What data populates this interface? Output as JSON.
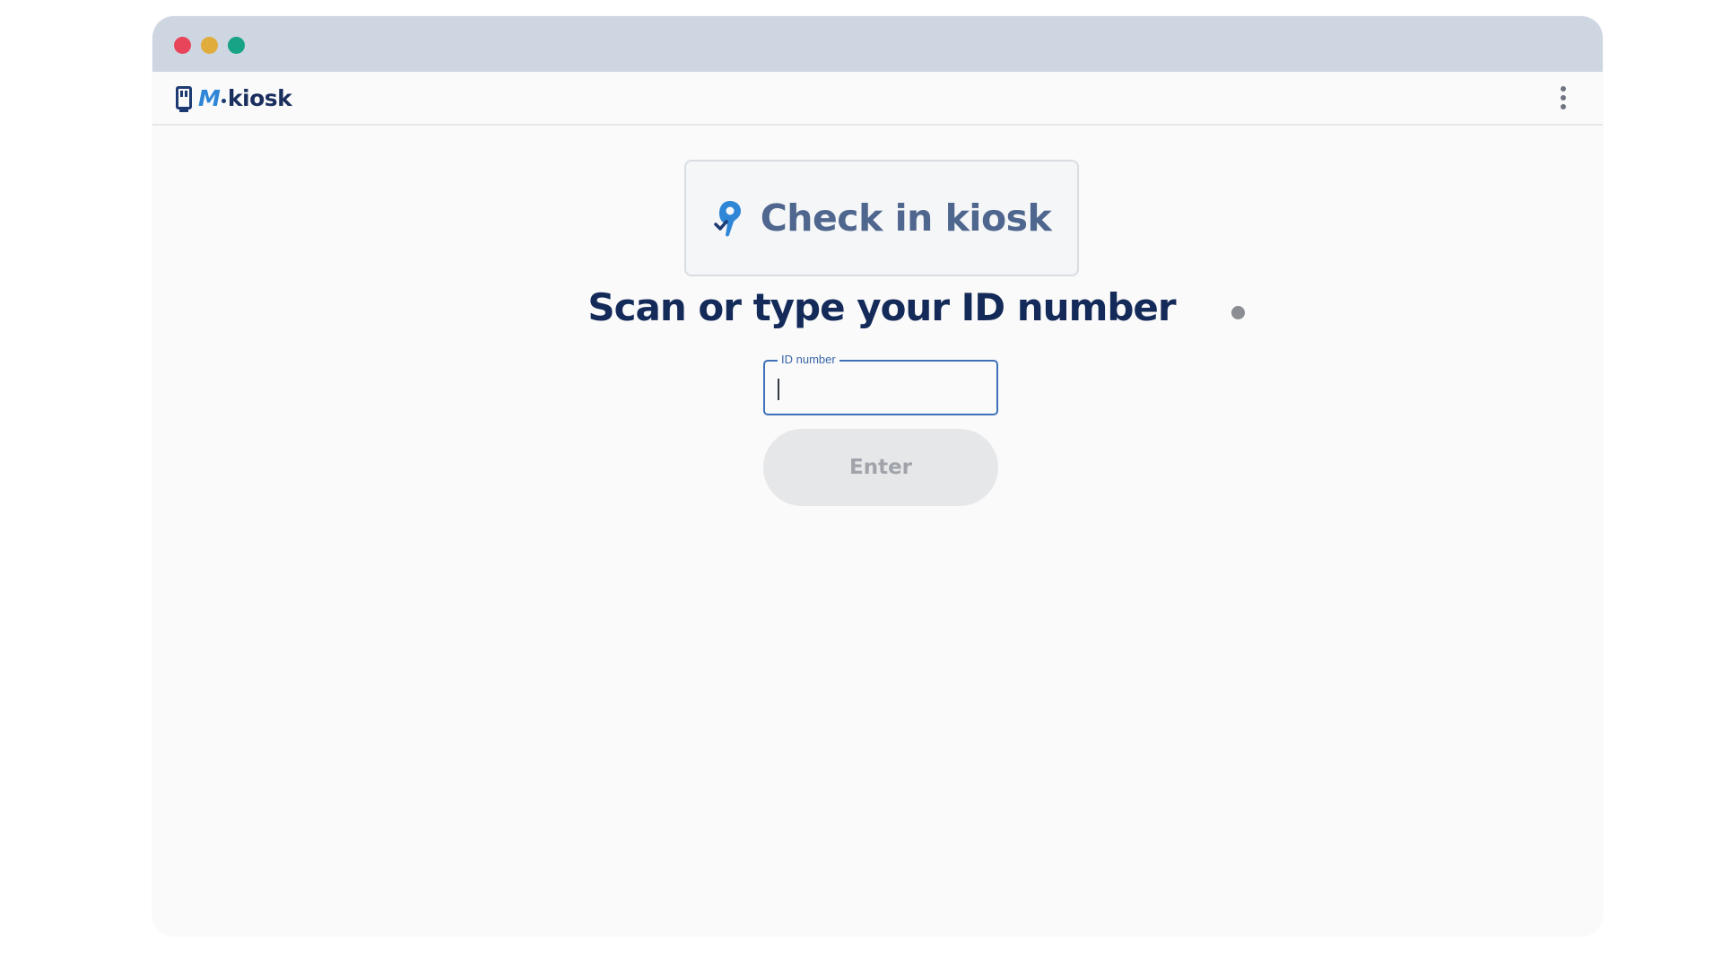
{
  "app": {
    "logo_m": "M",
    "logo_text": "kiosk"
  },
  "header": {
    "menu_icon": "more-vertical-icon"
  },
  "card": {
    "icon": "check-in-hand-icon",
    "title": "Check in kiosk",
    "icon_color": "#2f86d6"
  },
  "main": {
    "heading": "Scan or type your ID number",
    "id_field": {
      "label": "ID number",
      "value": ""
    },
    "enter_label": "Enter"
  },
  "colors": {
    "titlebar": "#cdd6e1",
    "heading": "#142a58",
    "field_border": "#3f70b8",
    "button_disabled_bg": "#e6e7e9",
    "window_red": "#e8455a",
    "window_yellow": "#e0ac3c",
    "window_green": "#16a386"
  }
}
